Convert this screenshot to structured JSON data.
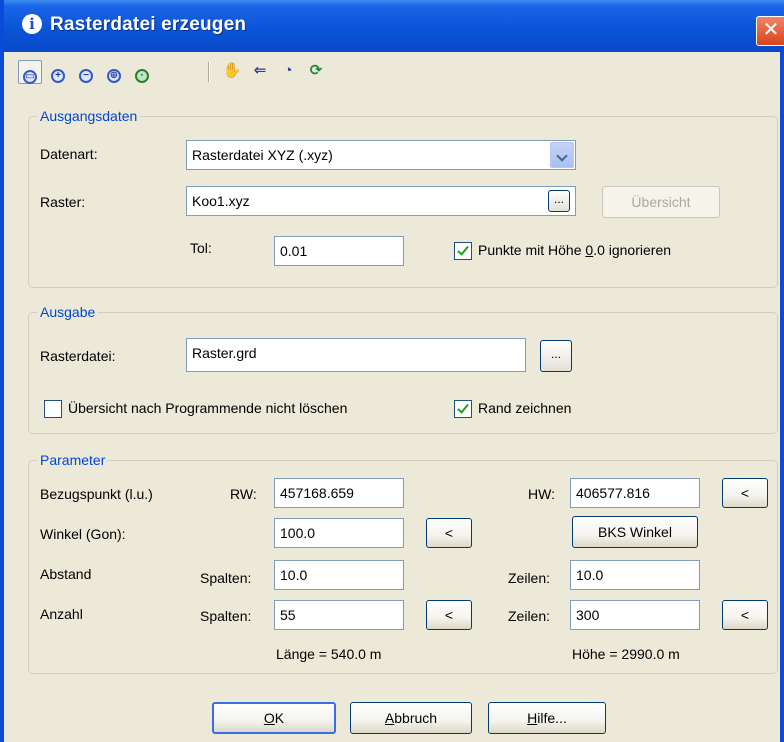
{
  "window": {
    "title": "Rasterdatei erzeugen",
    "close_glyph": "✕",
    "info_glyph": "i"
  },
  "toolbar": {
    "icons": [
      "zoom-window-icon",
      "zoom-in-icon",
      "zoom-out-icon",
      "zoom-all-icon",
      "zoom-realtime-icon",
      "pan-icon",
      "zoom-previous-icon",
      "zoom-extents-icon",
      "regen-icon"
    ]
  },
  "ausgangsdaten": {
    "legend": "Ausgangsdaten",
    "datenart_label": "Datenart:",
    "datenart_value": "Rasterdatei XYZ (.xyz)",
    "raster_label": "Raster:",
    "raster_value": "Koo1.xyz",
    "browse_label": "...",
    "uebersicht_label": "Übersicht",
    "tol_label": "Tol:",
    "tol_value": "0.01",
    "ignore_zero_prefix": "Punkte mit Höhe ",
    "ignore_zero_hotkey": "0",
    "ignore_zero_suffix": ".0 ignorieren",
    "ignore_zero_checked": true
  },
  "ausgabe": {
    "legend": "Ausgabe",
    "rasterdatei_label": "Rasterdatei:",
    "rasterdatei_value": "Raster.grd",
    "browse_label": "...",
    "keep_overview_label": "Übersicht nach Programmende nicht löschen",
    "keep_overview_checked": false,
    "rand_label": "Rand zeichnen",
    "rand_checked": true
  },
  "parameter": {
    "legend": "Parameter",
    "bezugspunkt_label": "Bezugspunkt (l.u.)",
    "rw_label": "RW:",
    "rw_value": "457168.659",
    "hw_label": "HW:",
    "hw_value": "406577.816",
    "pick_label": "<",
    "winkel_label": "Winkel (Gon):",
    "winkel_value": "100.0",
    "bks_label": "BKS Winkel",
    "abstand_label": "Abstand",
    "spalten_label": "Spalten:",
    "abstand_spalten_value": "10.0",
    "zeilen_label": "Zeilen:",
    "abstand_zeilen_value": "10.0",
    "anzahl_label": "Anzahl",
    "anzahl_spalten_value": "55",
    "anzahl_zeilen_value": "300",
    "laenge_text": "Länge = 540.0 m",
    "hoehe_text": "Höhe = 2990.0 m"
  },
  "buttons": {
    "ok_hotkey": "O",
    "ok_rest": "K",
    "abbruch_hotkey": "A",
    "abbruch_rest": "bbruch",
    "hilfe_hotkey": "H",
    "hilfe_rest": "ilfe..."
  }
}
